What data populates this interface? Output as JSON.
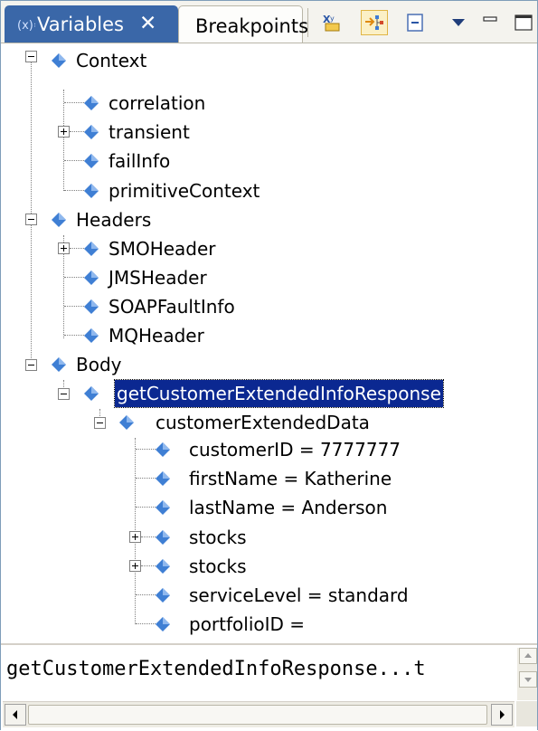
{
  "tabs": {
    "variables": "Variables",
    "breakpoints": "Breakpoints"
  },
  "icons": [
    "variables-icon",
    "close-icon",
    "collapse-all-icon",
    "show-type-names-icon",
    "show-logical-structure-icon",
    "view-menu-icon",
    "minimize-icon",
    "maximize-icon"
  ],
  "colors": {
    "selection": "#0b2891",
    "tab_active": "#3a67a8",
    "diamond": "#3f7fd4"
  },
  "tree": {
    "context": "Context",
    "correlation": "correlation",
    "transient": "transient",
    "failInfo": "failInfo",
    "primitiveContext": "primitiveContext",
    "headers": "Headers",
    "smoHeader": "SMOHeader",
    "jmsHeader": "JMSHeader",
    "soapFaultInfo": "SOAPFaultInfo",
    "mqHeader": "MQHeader",
    "body": "Body",
    "response": "getCustomerExtendedInfoResponse",
    "extendedData": "customerExtendedData",
    "customerID": "customerID = 7777777",
    "firstName": "firstName = Katherine",
    "lastName": "lastName = Anderson",
    "stocks1": "stocks",
    "stocks2": "stocks",
    "serviceLevel": "serviceLevel = standard",
    "portfolioID": "portfolioID ="
  },
  "detail": {
    "text": "getCustomerExtendedInfoResponse...t"
  }
}
